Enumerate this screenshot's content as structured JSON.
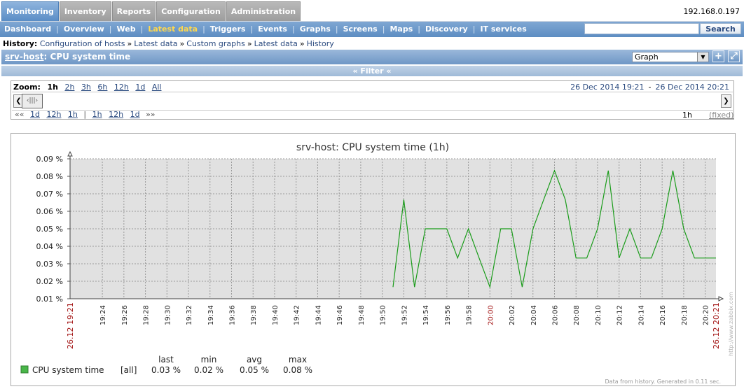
{
  "top_menu": {
    "items": [
      "Monitoring",
      "Inventory",
      "Reports",
      "Configuration",
      "Administration"
    ],
    "active_index": 0,
    "server_ip": "192.168.0.197"
  },
  "sub_menu": {
    "items": [
      "Dashboard",
      "Overview",
      "Web",
      "Latest data",
      "Triggers",
      "Events",
      "Graphs",
      "Screens",
      "Maps",
      "Discovery",
      "IT services"
    ],
    "active_index": 3,
    "search_placeholder": "",
    "search_button": "Search"
  },
  "history": {
    "label": "History:",
    "links": [
      "Configuration of hosts",
      "Latest data",
      "Custom graphs",
      "Latest data",
      "History"
    ]
  },
  "title": {
    "host": "srv-host",
    "item": ": CPU system time",
    "view_select": "Graph",
    "add_icon": "plus-icon",
    "fullscreen_icon": "fullscreen-icon"
  },
  "filter": {
    "label": "« Filter «"
  },
  "zoom": {
    "label": "Zoom:",
    "options": [
      "1h",
      "2h",
      "3h",
      "6h",
      "12h",
      "1d",
      "All"
    ],
    "current": "1h",
    "date_from": "26 Dec 2014 19:21",
    "date_sep": "-",
    "date_to": "26 Dec 2014 20:21",
    "nav_back_symbol": "««",
    "nav_back": [
      "1d",
      "12h",
      "1h"
    ],
    "nav_sep": "|",
    "nav_forward": [
      "1h",
      "12h",
      "1d"
    ],
    "nav_forward_symbol": "»»",
    "period": "1h",
    "fixed": "(fixed)"
  },
  "chart_data": {
    "type": "line",
    "title": "srv-host: CPU system time (1h)",
    "ylabel": "",
    "ylim": [
      0.01,
      0.09
    ],
    "y_ticks": [
      "0.01 %",
      "0.02 %",
      "0.03 %",
      "0.04 %",
      "0.05 %",
      "0.06 %",
      "0.07 %",
      "0.08 %",
      "0.09 %"
    ],
    "x_start_label": "26.12 19:21",
    "x_end_label": "26.12 20:21",
    "x_ticks": [
      "19:24",
      "19:26",
      "19:28",
      "19:30",
      "19:32",
      "19:34",
      "19:36",
      "19:38",
      "19:40",
      "19:42",
      "19:44",
      "19:46",
      "19:48",
      "19:50",
      "19:52",
      "19:54",
      "19:56",
      "19:58",
      "20:00",
      "20:02",
      "20:04",
      "20:06",
      "20:08",
      "20:10",
      "20:12",
      "20:14",
      "20:16",
      "20:18",
      "20:20"
    ],
    "x_highlight": "20:00",
    "grid": true,
    "watermark": "http://www.zabbix.com",
    "footer_note": "Data from history. Generated in 0.11 sec.",
    "legend_headers": [
      "last",
      "min",
      "avg",
      "max"
    ],
    "series": [
      {
        "name": "CPU system time",
        "func": "[all]",
        "last": "0.03 %",
        "min": "0.02 %",
        "avg": "0.05 %",
        "max": "0.08 %",
        "color": "#1a9c1a",
        "points": [
          [
            "19:51",
            0.0167
          ],
          [
            "19:52",
            0.0667
          ],
          [
            "19:53",
            0.0167
          ],
          [
            "19:54",
            0.05
          ],
          [
            "19:55",
            0.05
          ],
          [
            "19:56",
            0.05
          ],
          [
            "19:57",
            0.0333
          ],
          [
            "19:58",
            0.05
          ],
          [
            "19:59",
            0.0333
          ],
          [
            "20:00",
            0.0167
          ],
          [
            "20:01",
            0.05
          ],
          [
            "20:02",
            0.05
          ],
          [
            "20:03",
            0.0167
          ],
          [
            "20:04",
            0.05
          ],
          [
            "20:05",
            0.0667
          ],
          [
            "20:06",
            0.0833
          ],
          [
            "20:07",
            0.0667
          ],
          [
            "20:08",
            0.0333
          ],
          [
            "20:09",
            0.0333
          ],
          [
            "20:10",
            0.05
          ],
          [
            "20:11",
            0.0833
          ],
          [
            "20:12",
            0.0333
          ],
          [
            "20:13",
            0.05
          ],
          [
            "20:14",
            0.0333
          ],
          [
            "20:15",
            0.0333
          ],
          [
            "20:16",
            0.05
          ],
          [
            "20:17",
            0.0833
          ],
          [
            "20:18",
            0.05
          ],
          [
            "20:19",
            0.0333
          ],
          [
            "20:20",
            0.0333
          ],
          [
            "20:21",
            0.0333
          ]
        ]
      }
    ]
  }
}
